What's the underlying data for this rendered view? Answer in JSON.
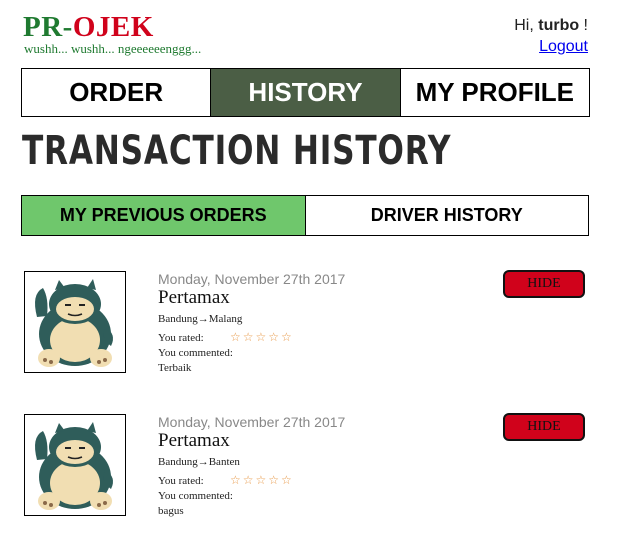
{
  "header": {
    "logo_pr": "PR",
    "logo_dash": "-",
    "logo_ojek": "OJEK",
    "tagline": "wushh... wushh... ngeeeeeenggg...",
    "greeting_prefix": "Hi, ",
    "username": "turbo",
    "greeting_suffix": " !",
    "logout_label": "Logout"
  },
  "nav": {
    "tabs": [
      {
        "label": "ORDER",
        "active": false
      },
      {
        "label": "HISTORY",
        "active": true
      },
      {
        "label": "MY PROFILE",
        "active": false
      }
    ]
  },
  "page_title": "TRANSACTION HISTORY",
  "subtabs": [
    {
      "label": "MY PREVIOUS ORDERS",
      "active": true
    },
    {
      "label": "DRIVER HISTORY",
      "active": false
    }
  ],
  "orders": [
    {
      "date": "Monday, November 27th 2017",
      "item": "Pertamax",
      "route": "Bandung→Malang",
      "rated_label": "You rated:",
      "stars": "☆☆☆☆☆",
      "commented_label": "You commented:",
      "comment": "Terbaik",
      "hide_label": "HIDE"
    },
    {
      "date": "Monday, November 27th 2017",
      "item": "Pertamax",
      "route": "Bandung→Banten",
      "rated_label": "You rated:",
      "stars": "☆☆☆☆☆",
      "commented_label": "You commented:",
      "comment": "bagus",
      "hide_label": "HIDE"
    }
  ],
  "colors": {
    "brand_green": "#1f7a30",
    "brand_red": "#d0021b",
    "nav_active": "#4b5e45",
    "subtab_active": "#6fc76c",
    "hide_button": "#d0021b"
  }
}
